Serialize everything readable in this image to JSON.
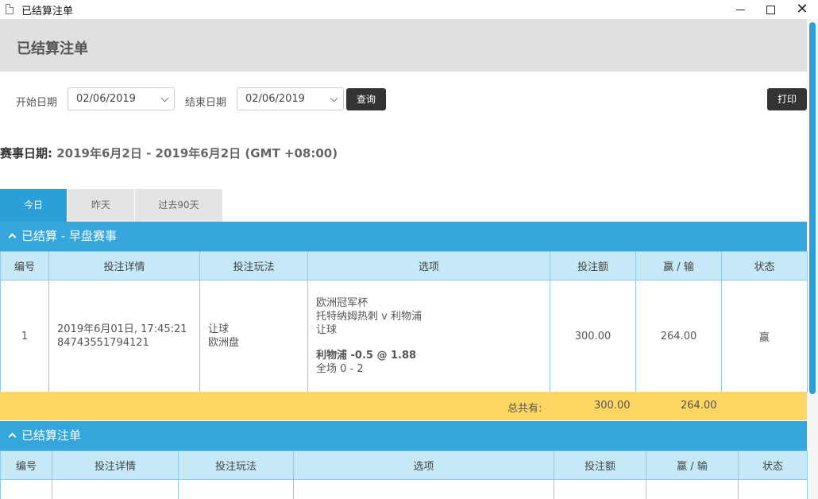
{
  "window": {
    "title": "已结算注单"
  },
  "page": {
    "title": "已结算注单"
  },
  "filters": {
    "start_label": "开始日期",
    "start_value": "02/06/2019",
    "end_label": "结束日期",
    "end_value": "02/06/2019",
    "query_button": "查询",
    "print_button": "打印"
  },
  "event_date": {
    "label": "赛事日期:",
    "value": "2019年6月2日 - 2019年6月2日 (GMT +08:00)"
  },
  "tabs": [
    {
      "label": "今日",
      "active": true
    },
    {
      "label": "昨天",
      "active": false
    },
    {
      "label": "过去90天",
      "active": false
    }
  ],
  "sections": [
    {
      "title": "已结算 - 早盘赛事",
      "columns": [
        "编号",
        "投注详情",
        "投注玩法",
        "选项",
        "投注额",
        "赢 / 输",
        "状态"
      ],
      "rows": [
        {
          "no": "1",
          "detail_time": "2019年6月01日, 17:45:21",
          "detail_id": "84743551794121",
          "play_type": "让球",
          "play_market": "欧洲盘",
          "opt_league": "欧洲冠军杯",
          "opt_match": "托特纳姆热刺 v 利物浦",
          "opt_market": "让球",
          "opt_pick": "利物浦 -0.5 @ 1.88",
          "opt_result": "全场 0 - 2",
          "stake": "300.00",
          "winloss": "264.00",
          "status": "赢"
        }
      ],
      "total": {
        "label": "总共有:",
        "stake": "300.00",
        "winloss": "264.00"
      }
    },
    {
      "title": "已结算注单",
      "columns": [
        "编号",
        "投注详情",
        "投注玩法",
        "选项",
        "投注额",
        "赢 / 输",
        "状态"
      ]
    }
  ],
  "colors": {
    "accent": "#2d9fd8",
    "section_header": "#35a6dc",
    "table_header": "#c6e9f8",
    "total_bar": "#fdd663",
    "win": "#2eaa4a"
  }
}
